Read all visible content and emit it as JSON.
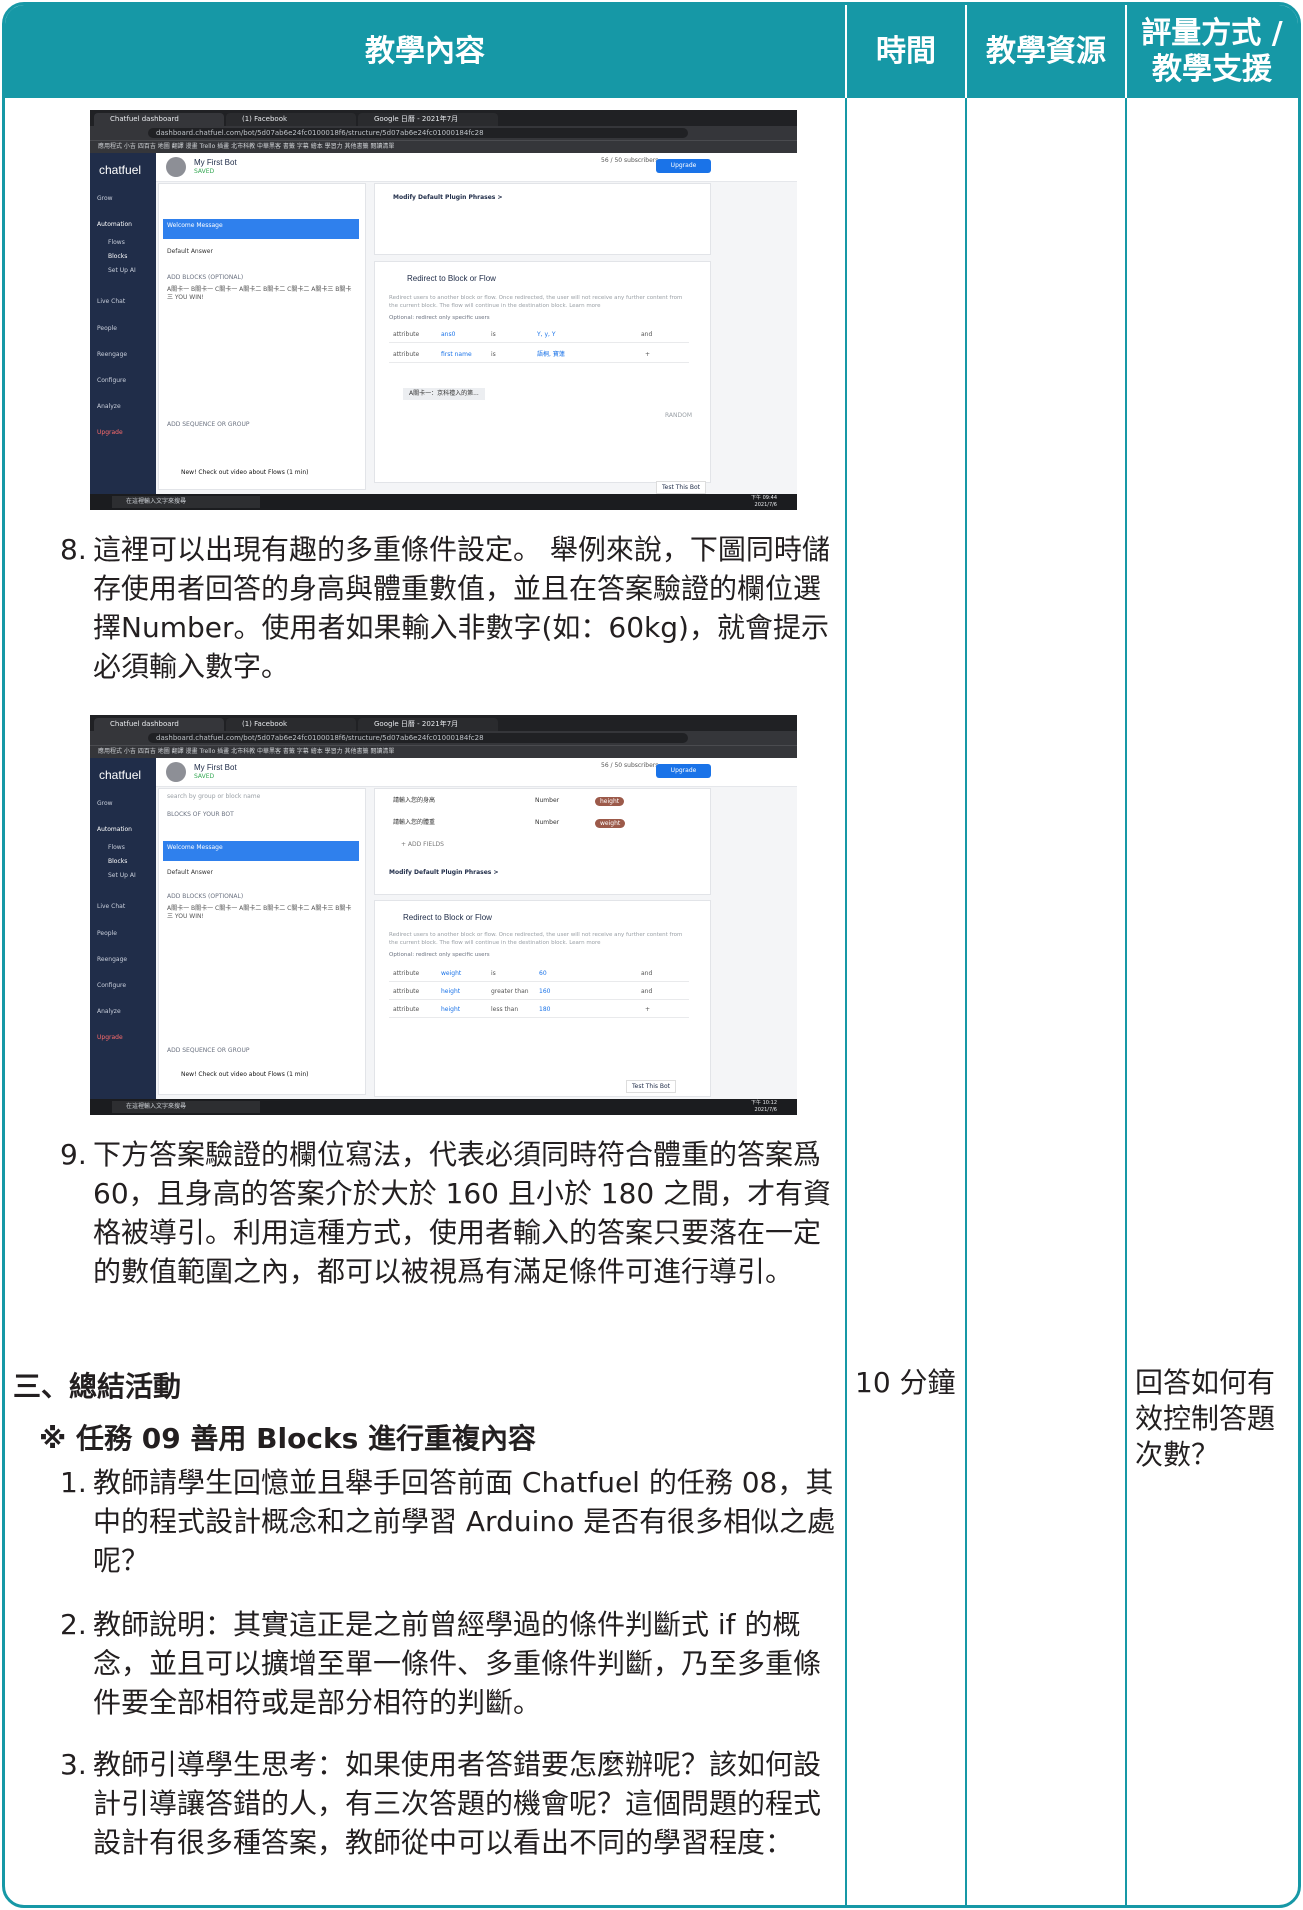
{
  "header": {
    "col1": "教學內容",
    "col2": "時間",
    "col3": "教學資源",
    "col4_line1": "評量方式 /",
    "col4_line2": "教學支援"
  },
  "screenshot1": {
    "tabs": [
      "Chatfuel dashboard",
      "(1) Facebook",
      "Google 日曆 - 2021年7月"
    ],
    "url": "dashboard.chatfuel.com/bot/5d07ab6e24fc0100018f6/structure/5d07ab6e24fc01000184fc28",
    "bookmarks": "應用程式 小吉 四百吉 地圖 翻譯 漫畫 Trello 插畫 北市科教 中華黑客 書籤 字幕 繪本 學習力 其他書籤 閱讀清單",
    "logo": "chatfuel",
    "sidebar": [
      "Grow",
      "Automation",
      "Flows",
      "Blocks",
      "Set Up AI",
      "Live Chat",
      "People",
      "Reengage",
      "Configure",
      "Analyze",
      "Upgrade"
    ],
    "bot_name": "My First Bot",
    "bot_status": "SAVED",
    "subscribers": "56 / 50 subscribers",
    "upgrade": "Upgrade",
    "welcome": "Welcome Message",
    "default_answer": "Default Answer",
    "add_blocks": "ADD BLOCKS (OPTIONAL)",
    "add_sequence": "ADD SEQUENCE OR GROUP",
    "video": "New! Check out video about Flows (1 min)",
    "phrases": "Modify Default Plugin Phrases >",
    "redirect_title": "Redirect to Block or Flow",
    "redirect_desc": "Redirect users to another block or flow. Once redirected, the user will not receive any further content from the current block. The flow will continue in the destination block. Learn more",
    "redirect_opt": "Optional: redirect only specific users",
    "rows": [
      {
        "a": "attribute",
        "b": "ans0",
        "c": "is",
        "d": "Y, y, Y",
        "e": "and"
      },
      {
        "a": "attribute",
        "b": "first name",
        "c": "is",
        "d": "語桐, 寶蓮",
        "e": "+"
      }
    ],
    "target": "A關卡一：京科禮入的第...",
    "random": "RANDOM",
    "test": "Test This Bot",
    "search": "在這裡輸入文字來搜尋",
    "clock1": "下午 09:44",
    "clock2": "2021/7/6"
  },
  "item8": {
    "num": "8.",
    "text": "這裡可以出現有趣的多重條件設定。 舉例來說，下圖同時儲存使用者回答的身高與體重數值，並且在答案驗證的欄位選擇Number。使用者如果輸入非數字(如：60kg)，就會提示必須輸入數字。"
  },
  "screenshot2": {
    "search_block": "search by group or block name",
    "blocks_label": "BLOCKS OF YOUR BOT",
    "field1": "請輸入您的身高",
    "field2": "請輸入您的體重",
    "number": "Number",
    "chip1": "height",
    "chip2": "weight",
    "add_fields": "+ ADD FIELDS",
    "rows": [
      {
        "a": "attribute",
        "b": "weight",
        "c": "is",
        "d": "60",
        "e": "and"
      },
      {
        "a": "attribute",
        "b": "height",
        "c": "greater than",
        "d": "160",
        "e": "and"
      },
      {
        "a": "attribute",
        "b": "height",
        "c": "less than",
        "d": "180",
        "e": "+"
      }
    ],
    "clock1": "下午 10:12",
    "clock2": "2021/7/6"
  },
  "item9": {
    "num": "9.",
    "text": "下方答案驗證的欄位寫法，代表必須同時符合體重的答案爲 60，且身高的答案介於大於 160 且小於 180 之間，才有資格被導引。利用這種方式，使用者輸入的答案只要落在一定的數值範圍之內，都可以被視爲有滿足條件可進行導引。"
  },
  "section3": {
    "title": "三、總結活動",
    "task": "※ 任務 09 善用 Blocks 進行重複內容",
    "time": "10 分鐘",
    "assess": "回答如何有效控制答題次數？",
    "items": [
      {
        "num": "1.",
        "text": "教師請學生回憶並且舉手回答前面 Chatfuel 的任務 08，其中的程式設計概念和之前學習 Arduino 是否有很多相似之處呢？"
      },
      {
        "num": "2.",
        "text": "教師說明：其實這正是之前曾經學過的條件判斷式 if 的概念，並且可以擴增至單一條件、多重條件判斷，乃至多重條件要全部相符或是部分相符的判斷。"
      },
      {
        "num": "3.",
        "text": "教師引導學生思考：如果使用者答錯要怎麼辦呢？該如何設計引導讓答錯的人，有三次答題的機會呢？這個問題的程式設計有很多種答案，教師從中可以看出不同的學習程度："
      }
    ]
  },
  "colors": {
    "teal": "#1698a6",
    "text": "#231f20"
  }
}
